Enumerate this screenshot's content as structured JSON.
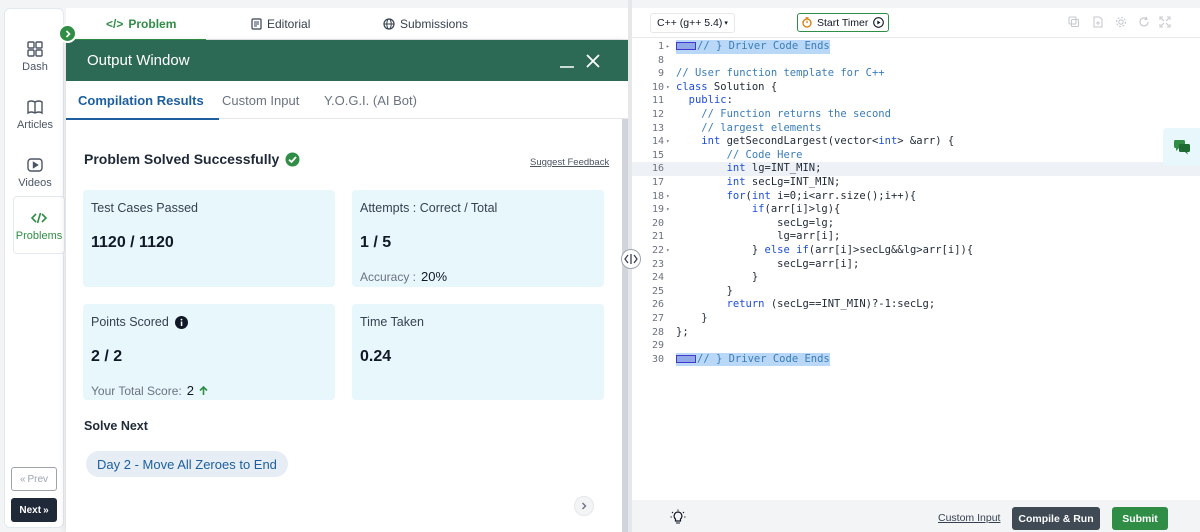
{
  "sidebar": {
    "items": [
      {
        "label": "Dash",
        "icon": "dashboard-icon"
      },
      {
        "label": "Articles",
        "icon": "book-icon"
      },
      {
        "label": "Videos",
        "icon": "video-icon"
      },
      {
        "label": "Problems",
        "icon": "code-icon"
      }
    ],
    "prev_label": "Prev",
    "next_label": "Next"
  },
  "top_tabs": [
    {
      "label": "Problem",
      "icon": "code-icon"
    },
    {
      "label": "Editorial",
      "icon": "document-icon"
    },
    {
      "label": "Submissions",
      "icon": "globe-icon"
    }
  ],
  "output_window": {
    "title": "Output Window",
    "tabs": [
      "Compilation Results",
      "Custom Input",
      "Y.O.G.I. (AI Bot)"
    ],
    "status": "Problem Solved Successfully",
    "suggest_feedback": "Suggest Feedback",
    "cards": {
      "test_cases": {
        "label": "Test Cases Passed",
        "value": "1120 / 1120"
      },
      "attempts": {
        "label": "Attempts : Correct / Total",
        "value": "1 / 5",
        "sub_label": "Accuracy :",
        "sub_value": "20%"
      },
      "points": {
        "label": "Points Scored",
        "value": "2 / 2",
        "sub_label": "Your Total Score:",
        "sub_value": "2"
      },
      "time": {
        "label": "Time Taken",
        "value": "0.24"
      }
    },
    "solve_next_label": "Solve Next",
    "next_problem": "Day 2 - Move All Zeroes to End"
  },
  "editor": {
    "language": "C++ (g++ 5.4)",
    "timer_label": "Start Timer",
    "code_lines": [
      {
        "n": "1",
        "fold": true,
        "text": "// } Driver Code Ends",
        "style": "sel"
      },
      {
        "n": "8",
        "fold": false,
        "text": "",
        "style": ""
      },
      {
        "n": "9",
        "fold": false,
        "text": "// User function template for C++",
        "style": ""
      },
      {
        "n": "10",
        "fold": true,
        "text": "class Solution {",
        "style": ""
      },
      {
        "n": "11",
        "fold": false,
        "text": "  public:",
        "style": ""
      },
      {
        "n": "12",
        "fold": false,
        "text": "    // Function returns the second",
        "style": ""
      },
      {
        "n": "13",
        "fold": false,
        "text": "    // largest elements",
        "style": ""
      },
      {
        "n": "14",
        "fold": true,
        "text": "    int getSecondLargest(vector<int> &arr) {",
        "style": ""
      },
      {
        "n": "15",
        "fold": false,
        "text": "        // Code Here",
        "style": ""
      },
      {
        "n": "16",
        "fold": false,
        "text": "        int lg=INT_MIN;",
        "style": "active"
      },
      {
        "n": "17",
        "fold": false,
        "text": "        int secLg=INT_MIN;",
        "style": ""
      },
      {
        "n": "18",
        "fold": true,
        "text": "        for(int i=0;i<arr.size();i++){",
        "style": ""
      },
      {
        "n": "19",
        "fold": true,
        "text": "            if(arr[i]>lg){",
        "style": ""
      },
      {
        "n": "20",
        "fold": false,
        "text": "                secLg=lg;",
        "style": ""
      },
      {
        "n": "21",
        "fold": false,
        "text": "                lg=arr[i];",
        "style": ""
      },
      {
        "n": "22",
        "fold": true,
        "text": "            } else if(arr[i]>secLg&&lg>arr[i]){",
        "style": ""
      },
      {
        "n": "23",
        "fold": false,
        "text": "                secLg=arr[i];",
        "style": ""
      },
      {
        "n": "24",
        "fold": false,
        "text": "            }",
        "style": ""
      },
      {
        "n": "25",
        "fold": false,
        "text": "        }",
        "style": ""
      },
      {
        "n": "26",
        "fold": false,
        "text": "        return (secLg==INT_MIN)?-1:secLg;",
        "style": ""
      },
      {
        "n": "27",
        "fold": false,
        "text": "    }",
        "style": ""
      },
      {
        "n": "28",
        "fold": false,
        "text": "};",
        "style": ""
      },
      {
        "n": "29",
        "fold": false,
        "text": "",
        "style": ""
      },
      {
        "n": "30",
        "fold": false,
        "text": "// } Driver Code Ends",
        "style": "sel"
      }
    ],
    "custom_input_label": "Custom Input",
    "compile_label": "Compile & Run",
    "submit_label": "Submit"
  },
  "colors": {
    "brand_green": "#2f8d46",
    "header_green": "#2d6a55",
    "link_blue": "#1d5f9e",
    "card_bg": "#e8f7fb"
  }
}
